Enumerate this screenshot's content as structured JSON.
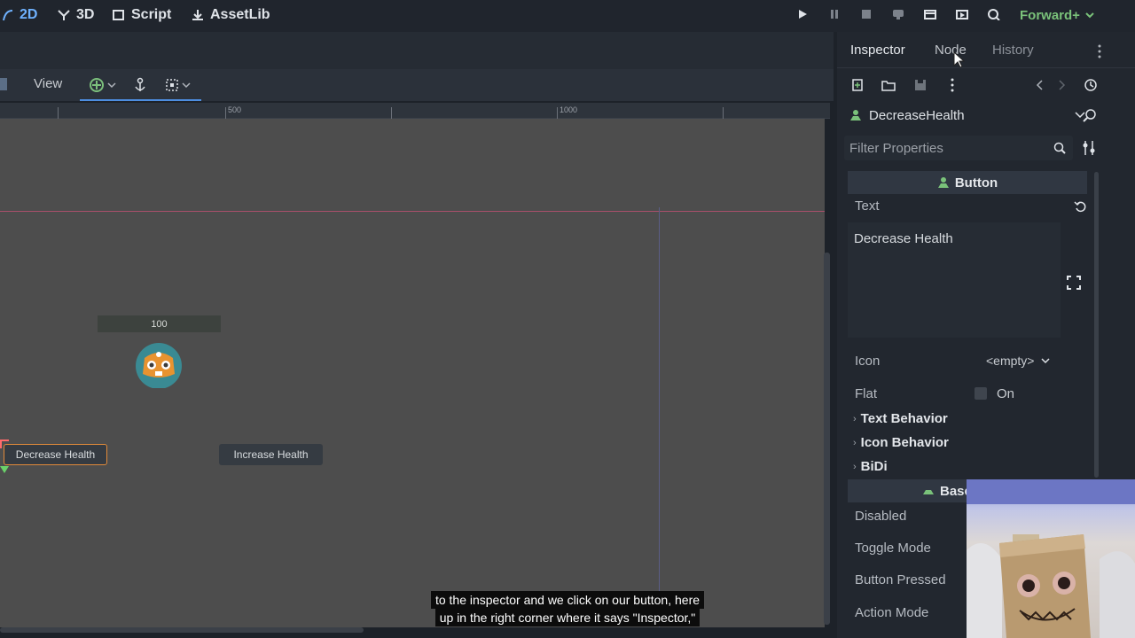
{
  "workspace_tabs": [
    {
      "label": "2D",
      "icon": "2d-icon",
      "active": true
    },
    {
      "label": "3D",
      "icon": "3d-icon",
      "active": false
    },
    {
      "label": "Script",
      "icon": "script-icon",
      "active": false
    },
    {
      "label": "AssetLib",
      "icon": "assetlib-icon",
      "active": false
    }
  ],
  "run_controls": [
    "play-icon",
    "pause-icon",
    "stop-icon",
    "remote-debug-icon",
    "movie-icon",
    "play-scene-icon",
    "play-custom-icon"
  ],
  "renderer": {
    "label": "Forward+",
    "color": "#7ac27a"
  },
  "viewport": {
    "view_menu": "View",
    "ruler_labels": [
      "500",
      "1000"
    ],
    "health_label": "100",
    "buttons": {
      "decrease": "Decrease Health",
      "increase": "Increase Health"
    },
    "selected_color": "#e08a3a"
  },
  "dock": {
    "tabs": [
      "Inspector",
      "Node",
      "History"
    ],
    "node_name": "DecreaseHealth",
    "filter_placeholder": "Filter Properties",
    "section_title": "Button",
    "props": {
      "text_label": "Text",
      "text_value": "Decrease Health",
      "icon_label": "Icon",
      "icon_value": "<empty>",
      "flat_label": "Flat",
      "flat_value": "On"
    },
    "groups": [
      "Text Behavior",
      "Icon Behavior",
      "BiDi"
    ],
    "base_section": "Base",
    "base_props": [
      "Disabled",
      "Toggle Mode",
      "Button Pressed",
      "Action Mode"
    ]
  },
  "subtitle": {
    "line1": "to the inspector and we click on our button, here",
    "line2": "up in the right corner where it says \"Inspector,\""
  }
}
